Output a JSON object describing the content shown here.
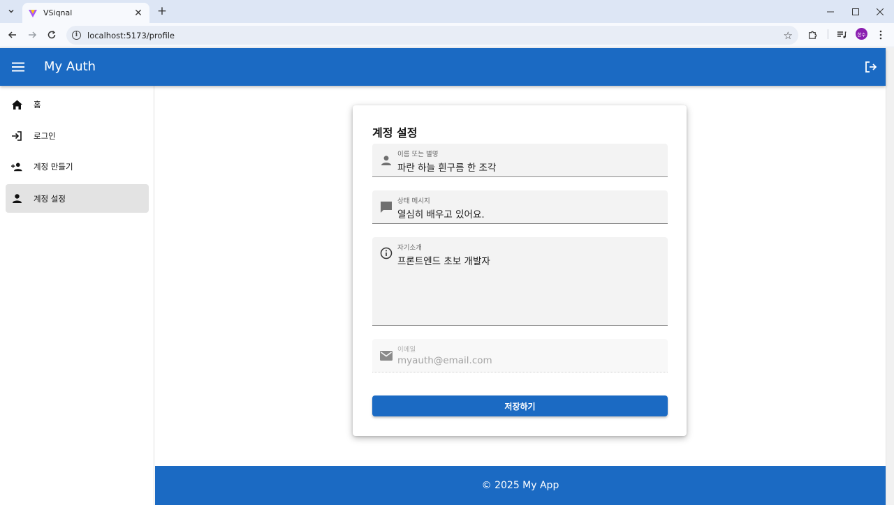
{
  "browser": {
    "tab_title": "VSiqnal",
    "url": "localhost:5173/profile",
    "profile_initials": "한수"
  },
  "app": {
    "title": "My Auth",
    "brand_color": "#1b6ac3"
  },
  "sidebar": {
    "items": [
      {
        "label": "홈",
        "icon": "home-icon"
      },
      {
        "label": "로그인",
        "icon": "login-icon"
      },
      {
        "label": "계정 만들기",
        "icon": "person-add-icon"
      },
      {
        "label": "계정 설정",
        "icon": "person-icon",
        "active": true
      }
    ]
  },
  "form": {
    "title": "계정 설정",
    "name": {
      "label": "이름 또는 별명",
      "value": "파란 하늘 흰구름 한 조각",
      "icon": "person-icon"
    },
    "status": {
      "label": "상태 메시지",
      "value": "열심히 배우고 있어요.",
      "icon": "chat-icon"
    },
    "bio": {
      "label": "자기소개",
      "value": "프론트엔드 초보 개발자",
      "icon": "info-icon"
    },
    "email": {
      "label": "이메일",
      "value": "myauth@email.com",
      "icon": "mail-icon",
      "disabled": true
    },
    "save_label": "저장하기"
  },
  "footer": {
    "text": "© 2025 My App"
  }
}
